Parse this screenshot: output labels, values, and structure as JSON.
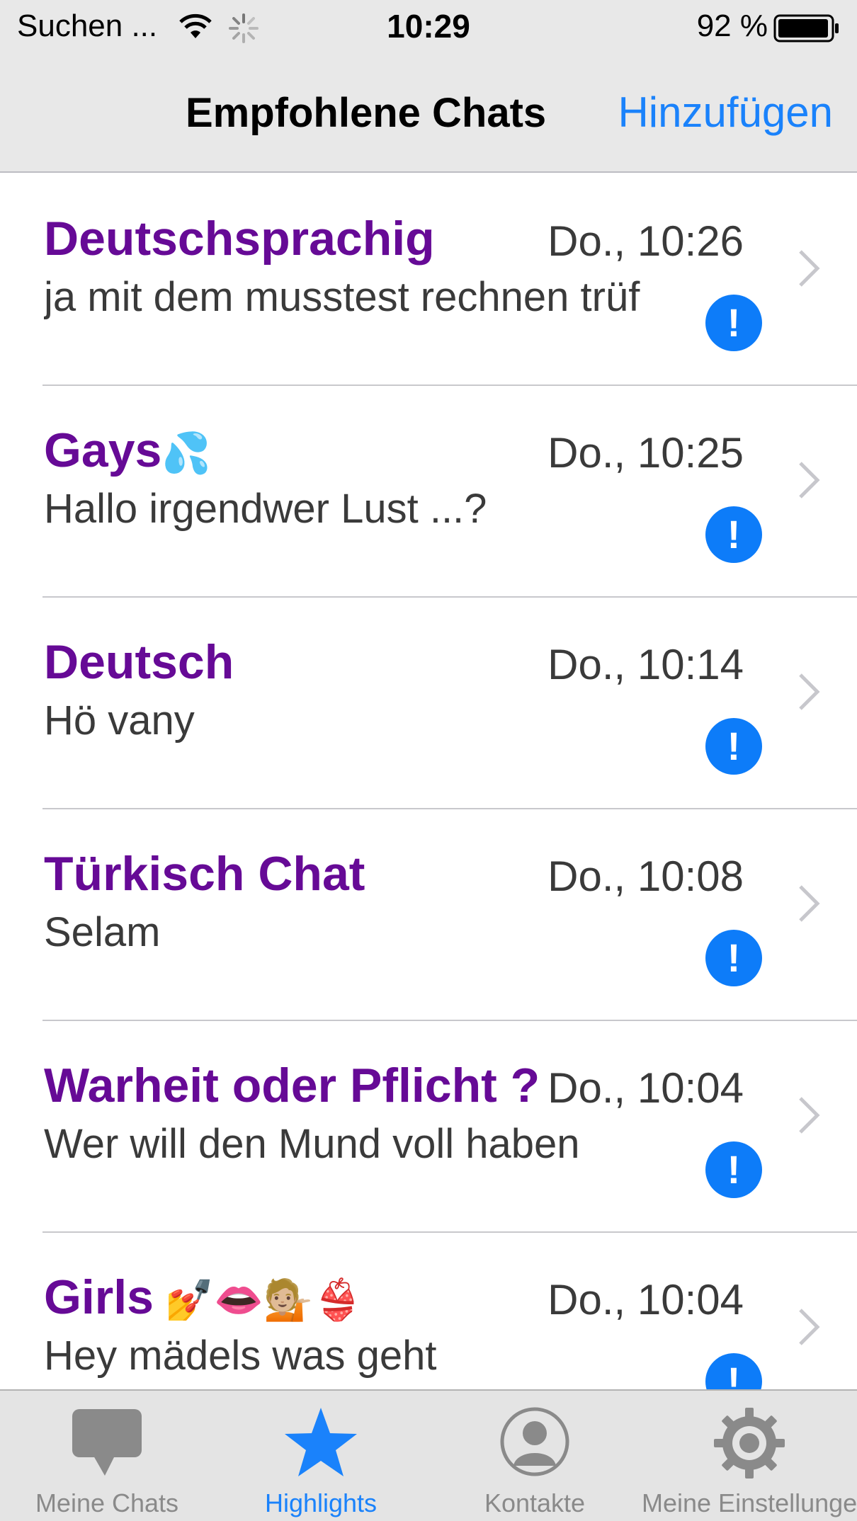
{
  "status_bar": {
    "carrier": "Suchen ...",
    "time": "10:29",
    "battery": "92 %"
  },
  "nav": {
    "title": "Empfohlene Chats",
    "add_label": "Hinzufügen"
  },
  "chats": [
    {
      "name": "Deutschsprachig",
      "emoji": "",
      "time": "Do., 10:26",
      "message": "ja mit dem musstest rechnen trüf",
      "badge": "!"
    },
    {
      "name": "Gays",
      "emoji": "💦",
      "time": "Do., 10:25",
      "message": "Hallo irgendwer Lust ...?",
      "badge": "!"
    },
    {
      "name": "Deutsch",
      "emoji": "",
      "time": "Do., 10:14",
      "message": "Hö vany",
      "badge": "!"
    },
    {
      "name": "Türkisch Chat",
      "emoji": "",
      "time": "Do., 10:08",
      "message": "Selam",
      "badge": "!"
    },
    {
      "name": "Warheit oder Pflicht ?",
      "emoji": "",
      "time": "Do., 10:04",
      "message": "Wer will den Mund voll haben",
      "badge": "!"
    },
    {
      "name": "Girls",
      "emoji": " 💅👄💁🏼👙",
      "time": "Do., 10:04",
      "message": "Hey mädels was geht",
      "badge": "!"
    }
  ],
  "tabs": [
    {
      "label": "Meine Chats",
      "icon": "speech-bubble-icon",
      "active": false
    },
    {
      "label": "Highlights",
      "icon": "star-icon",
      "active": true
    },
    {
      "label": "Kontakte",
      "icon": "person-icon",
      "active": false
    },
    {
      "label": "Meine Einstellungen",
      "icon": "gear-icon",
      "active": false
    }
  ],
  "colors": {
    "accent": "#1a82fb",
    "chat_name": "#660a96",
    "badge": "#0d7cf9",
    "tab_inactive": "#8a8a8a"
  }
}
